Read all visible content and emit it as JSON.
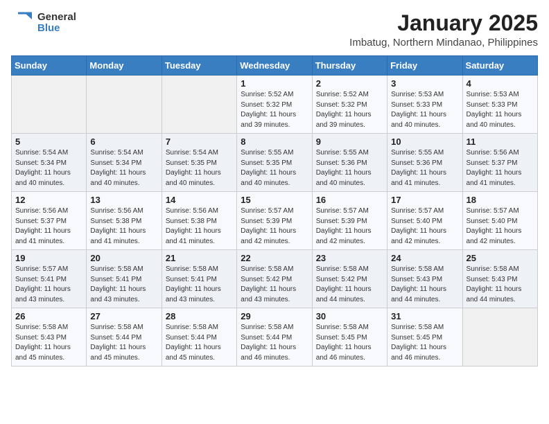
{
  "logo": {
    "text_general": "General",
    "text_blue": "Blue"
  },
  "title": "January 2025",
  "subtitle": "Imbatug, Northern Mindanao, Philippines",
  "days_header": [
    "Sunday",
    "Monday",
    "Tuesday",
    "Wednesday",
    "Thursday",
    "Friday",
    "Saturday"
  ],
  "weeks": [
    [
      {
        "day": "",
        "sunrise": "",
        "sunset": "",
        "daylight": ""
      },
      {
        "day": "",
        "sunrise": "",
        "sunset": "",
        "daylight": ""
      },
      {
        "day": "",
        "sunrise": "",
        "sunset": "",
        "daylight": ""
      },
      {
        "day": "1",
        "sunrise": "Sunrise: 5:52 AM",
        "sunset": "Sunset: 5:32 PM",
        "daylight": "Daylight: 11 hours and 39 minutes."
      },
      {
        "day": "2",
        "sunrise": "Sunrise: 5:52 AM",
        "sunset": "Sunset: 5:32 PM",
        "daylight": "Daylight: 11 hours and 39 minutes."
      },
      {
        "day": "3",
        "sunrise": "Sunrise: 5:53 AM",
        "sunset": "Sunset: 5:33 PM",
        "daylight": "Daylight: 11 hours and 40 minutes."
      },
      {
        "day": "4",
        "sunrise": "Sunrise: 5:53 AM",
        "sunset": "Sunset: 5:33 PM",
        "daylight": "Daylight: 11 hours and 40 minutes."
      }
    ],
    [
      {
        "day": "5",
        "sunrise": "Sunrise: 5:54 AM",
        "sunset": "Sunset: 5:34 PM",
        "daylight": "Daylight: 11 hours and 40 minutes."
      },
      {
        "day": "6",
        "sunrise": "Sunrise: 5:54 AM",
        "sunset": "Sunset: 5:34 PM",
        "daylight": "Daylight: 11 hours and 40 minutes."
      },
      {
        "day": "7",
        "sunrise": "Sunrise: 5:54 AM",
        "sunset": "Sunset: 5:35 PM",
        "daylight": "Daylight: 11 hours and 40 minutes."
      },
      {
        "day": "8",
        "sunrise": "Sunrise: 5:55 AM",
        "sunset": "Sunset: 5:35 PM",
        "daylight": "Daylight: 11 hours and 40 minutes."
      },
      {
        "day": "9",
        "sunrise": "Sunrise: 5:55 AM",
        "sunset": "Sunset: 5:36 PM",
        "daylight": "Daylight: 11 hours and 40 minutes."
      },
      {
        "day": "10",
        "sunrise": "Sunrise: 5:55 AM",
        "sunset": "Sunset: 5:36 PM",
        "daylight": "Daylight: 11 hours and 41 minutes."
      },
      {
        "day": "11",
        "sunrise": "Sunrise: 5:56 AM",
        "sunset": "Sunset: 5:37 PM",
        "daylight": "Daylight: 11 hours and 41 minutes."
      }
    ],
    [
      {
        "day": "12",
        "sunrise": "Sunrise: 5:56 AM",
        "sunset": "Sunset: 5:37 PM",
        "daylight": "Daylight: 11 hours and 41 minutes."
      },
      {
        "day": "13",
        "sunrise": "Sunrise: 5:56 AM",
        "sunset": "Sunset: 5:38 PM",
        "daylight": "Daylight: 11 hours and 41 minutes."
      },
      {
        "day": "14",
        "sunrise": "Sunrise: 5:56 AM",
        "sunset": "Sunset: 5:38 PM",
        "daylight": "Daylight: 11 hours and 41 minutes."
      },
      {
        "day": "15",
        "sunrise": "Sunrise: 5:57 AM",
        "sunset": "Sunset: 5:39 PM",
        "daylight": "Daylight: 11 hours and 42 minutes."
      },
      {
        "day": "16",
        "sunrise": "Sunrise: 5:57 AM",
        "sunset": "Sunset: 5:39 PM",
        "daylight": "Daylight: 11 hours and 42 minutes."
      },
      {
        "day": "17",
        "sunrise": "Sunrise: 5:57 AM",
        "sunset": "Sunset: 5:40 PM",
        "daylight": "Daylight: 11 hours and 42 minutes."
      },
      {
        "day": "18",
        "sunrise": "Sunrise: 5:57 AM",
        "sunset": "Sunset: 5:40 PM",
        "daylight": "Daylight: 11 hours and 42 minutes."
      }
    ],
    [
      {
        "day": "19",
        "sunrise": "Sunrise: 5:57 AM",
        "sunset": "Sunset: 5:41 PM",
        "daylight": "Daylight: 11 hours and 43 minutes."
      },
      {
        "day": "20",
        "sunrise": "Sunrise: 5:58 AM",
        "sunset": "Sunset: 5:41 PM",
        "daylight": "Daylight: 11 hours and 43 minutes."
      },
      {
        "day": "21",
        "sunrise": "Sunrise: 5:58 AM",
        "sunset": "Sunset: 5:41 PM",
        "daylight": "Daylight: 11 hours and 43 minutes."
      },
      {
        "day": "22",
        "sunrise": "Sunrise: 5:58 AM",
        "sunset": "Sunset: 5:42 PM",
        "daylight": "Daylight: 11 hours and 43 minutes."
      },
      {
        "day": "23",
        "sunrise": "Sunrise: 5:58 AM",
        "sunset": "Sunset: 5:42 PM",
        "daylight": "Daylight: 11 hours and 44 minutes."
      },
      {
        "day": "24",
        "sunrise": "Sunrise: 5:58 AM",
        "sunset": "Sunset: 5:43 PM",
        "daylight": "Daylight: 11 hours and 44 minutes."
      },
      {
        "day": "25",
        "sunrise": "Sunrise: 5:58 AM",
        "sunset": "Sunset: 5:43 PM",
        "daylight": "Daylight: 11 hours and 44 minutes."
      }
    ],
    [
      {
        "day": "26",
        "sunrise": "Sunrise: 5:58 AM",
        "sunset": "Sunset: 5:43 PM",
        "daylight": "Daylight: 11 hours and 45 minutes."
      },
      {
        "day": "27",
        "sunrise": "Sunrise: 5:58 AM",
        "sunset": "Sunset: 5:44 PM",
        "daylight": "Daylight: 11 hours and 45 minutes."
      },
      {
        "day": "28",
        "sunrise": "Sunrise: 5:58 AM",
        "sunset": "Sunset: 5:44 PM",
        "daylight": "Daylight: 11 hours and 45 minutes."
      },
      {
        "day": "29",
        "sunrise": "Sunrise: 5:58 AM",
        "sunset": "Sunset: 5:44 PM",
        "daylight": "Daylight: 11 hours and 46 minutes."
      },
      {
        "day": "30",
        "sunrise": "Sunrise: 5:58 AM",
        "sunset": "Sunset: 5:45 PM",
        "daylight": "Daylight: 11 hours and 46 minutes."
      },
      {
        "day": "31",
        "sunrise": "Sunrise: 5:58 AM",
        "sunset": "Sunset: 5:45 PM",
        "daylight": "Daylight: 11 hours and 46 minutes."
      },
      {
        "day": "",
        "sunrise": "",
        "sunset": "",
        "daylight": ""
      }
    ]
  ]
}
